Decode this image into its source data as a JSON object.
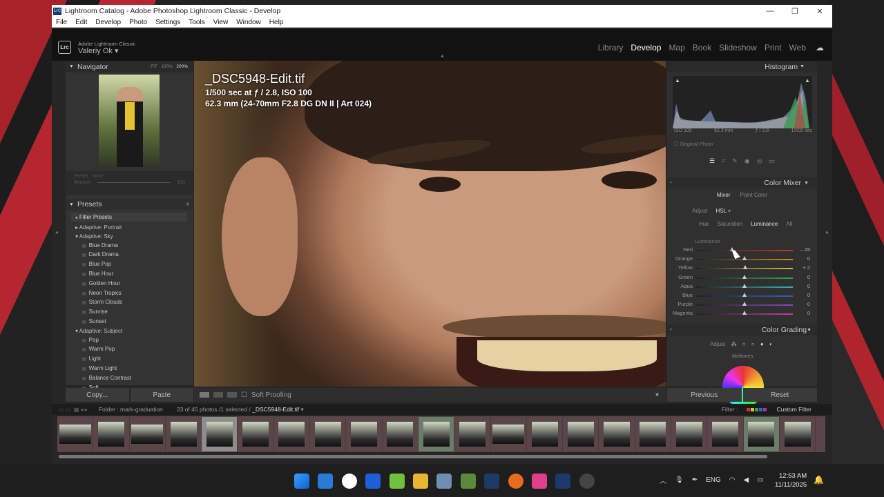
{
  "window": {
    "title": "Lightroom Catalog - Adobe Photoshop Lightroom Classic - Develop",
    "app_icon": "LrC",
    "controls": [
      "—",
      "❐",
      "✕"
    ]
  },
  "menu": [
    "File",
    "Edit",
    "Develop",
    "Photo",
    "Settings",
    "Tools",
    "View",
    "Window",
    "Help"
  ],
  "identity": {
    "brand": "Adobe Lightroom Classic",
    "user": "Valeriy Ok",
    "logo": "Lrc"
  },
  "modules": [
    "Library",
    "Develop",
    "Map",
    "Book",
    "Slideshow",
    "Print",
    "Web"
  ],
  "navigator": {
    "title": "Navigator",
    "zoom_fit": "FIT",
    "zoom_100": "100%",
    "zoom_200": "200%"
  },
  "preset_mini": {
    "preset_label": "Preset",
    "preset_value": "None",
    "amount_label": "Amount",
    "amount_value": "100"
  },
  "presets": {
    "title": "Presets",
    "filter": "Filter Presets",
    "groups": [
      {
        "name": "Adaptive: Portrait",
        "expanded": false,
        "items": []
      },
      {
        "name": "Adaptive: Sky",
        "expanded": true,
        "items": [
          "Blue Drama",
          "Dark Drama",
          "Blue Pop",
          "Blue Hour",
          "Golden Hour",
          "Neon Tropics",
          "Storm Clouds",
          "Sunrise",
          "Sunset"
        ]
      },
      {
        "name": "Adaptive: Subject",
        "expanded": true,
        "items": [
          "Pop",
          "Warm Pop",
          "Light",
          "Warm Light",
          "Balance Contrast",
          "Soft"
        ]
      }
    ]
  },
  "left_buttons": {
    "copy": "Copy...",
    "paste": "Paste"
  },
  "photo_info": {
    "filename": "_DSC5948-Edit.tif",
    "exposure": "1/500 sec at ƒ / 2.8, ISO 100",
    "lens": "62.3 mm (24-70mm F2.8 DG DN II | Art 024)"
  },
  "toolbar": {
    "soft_proofing": "Soft Proofing"
  },
  "histogram": {
    "title": "Histogram",
    "iso": "ISO 100",
    "focal": "62.3 mm",
    "aperture": "ƒ / 2.8",
    "shutter": "1/500 sec",
    "original_photo": "Original Photo"
  },
  "color_mixer": {
    "title": "Color Mixer",
    "tab_mixer": "Mixer",
    "tab_point": "Point Color",
    "adjust_label": "Adjust",
    "adjust_value": "HSL",
    "subtabs": [
      "Hue",
      "Saturation",
      "Luminance",
      "All"
    ],
    "section": "Luminance",
    "sliders": [
      {
        "name": "Red",
        "value": "– 28",
        "pos": 0.37,
        "color": "#c0392b"
      },
      {
        "name": "Orange",
        "value": "0",
        "pos": 0.5,
        "color": "#d9822b"
      },
      {
        "name": "Yellow",
        "value": "+ 2",
        "pos": 0.51,
        "color": "#d4c030"
      },
      {
        "name": "Green",
        "value": "0",
        "pos": 0.5,
        "color": "#3aa04a"
      },
      {
        "name": "Aqua",
        "value": "0",
        "pos": 0.5,
        "color": "#36b0b0"
      },
      {
        "name": "Blue",
        "value": "0",
        "pos": 0.5,
        "color": "#3560c0"
      },
      {
        "name": "Purple",
        "value": "0",
        "pos": 0.5,
        "color": "#8a48c0"
      },
      {
        "name": "Magenta",
        "value": "0",
        "pos": 0.5,
        "color": "#c040a0"
      }
    ]
  },
  "color_grading": {
    "title": "Color Grading",
    "adjust_label": "Adjust",
    "midtones": "Midtones"
  },
  "right_buttons": {
    "previous": "Previous",
    "reset": "Reset"
  },
  "filmbar": {
    "folder": "Folder : mark-graduation",
    "count": "23 of 45 photos /1 selected /",
    "selected": "_DSC5948-Edit.tif",
    "filter": "Filter :",
    "custom": "Custom Filter"
  },
  "filmstrip_count": 21,
  "taskbar": {
    "lang": "ENG",
    "time": "12:53 AM",
    "date": "11/11/2025"
  }
}
